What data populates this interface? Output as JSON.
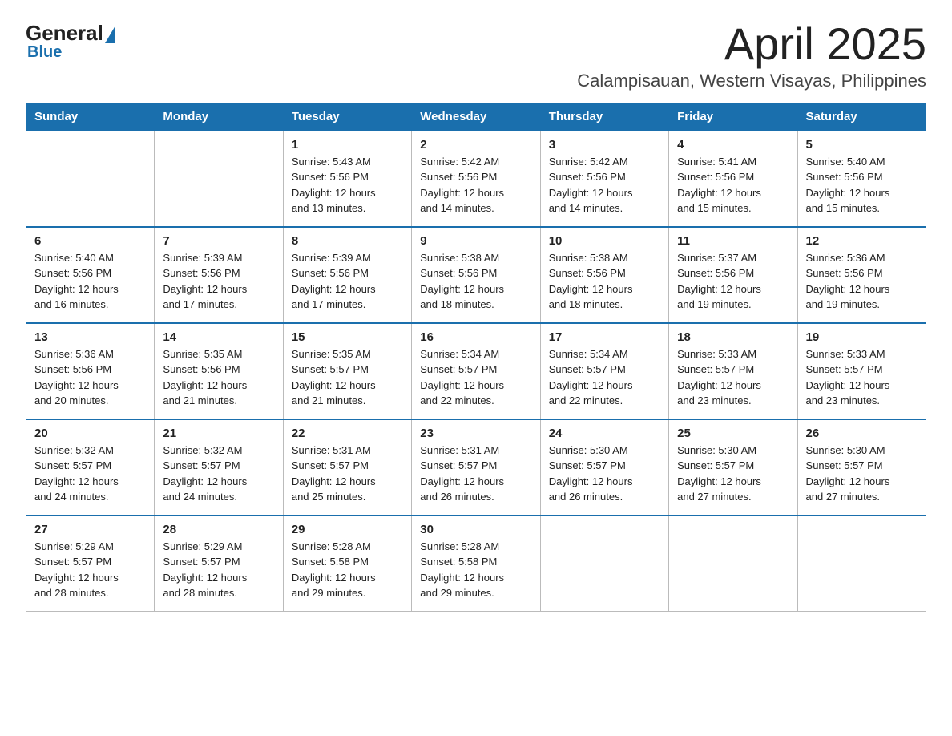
{
  "logo": {
    "general": "General",
    "blue": "Blue"
  },
  "title": "April 2025",
  "subtitle": "Calampisauan, Western Visayas, Philippines",
  "weekdays": [
    "Sunday",
    "Monday",
    "Tuesday",
    "Wednesday",
    "Thursday",
    "Friday",
    "Saturday"
  ],
  "weeks": [
    [
      {
        "day": "",
        "info": ""
      },
      {
        "day": "",
        "info": ""
      },
      {
        "day": "1",
        "info": "Sunrise: 5:43 AM\nSunset: 5:56 PM\nDaylight: 12 hours\nand 13 minutes."
      },
      {
        "day": "2",
        "info": "Sunrise: 5:42 AM\nSunset: 5:56 PM\nDaylight: 12 hours\nand 14 minutes."
      },
      {
        "day": "3",
        "info": "Sunrise: 5:42 AM\nSunset: 5:56 PM\nDaylight: 12 hours\nand 14 minutes."
      },
      {
        "day": "4",
        "info": "Sunrise: 5:41 AM\nSunset: 5:56 PM\nDaylight: 12 hours\nand 15 minutes."
      },
      {
        "day": "5",
        "info": "Sunrise: 5:40 AM\nSunset: 5:56 PM\nDaylight: 12 hours\nand 15 minutes."
      }
    ],
    [
      {
        "day": "6",
        "info": "Sunrise: 5:40 AM\nSunset: 5:56 PM\nDaylight: 12 hours\nand 16 minutes."
      },
      {
        "day": "7",
        "info": "Sunrise: 5:39 AM\nSunset: 5:56 PM\nDaylight: 12 hours\nand 17 minutes."
      },
      {
        "day": "8",
        "info": "Sunrise: 5:39 AM\nSunset: 5:56 PM\nDaylight: 12 hours\nand 17 minutes."
      },
      {
        "day": "9",
        "info": "Sunrise: 5:38 AM\nSunset: 5:56 PM\nDaylight: 12 hours\nand 18 minutes."
      },
      {
        "day": "10",
        "info": "Sunrise: 5:38 AM\nSunset: 5:56 PM\nDaylight: 12 hours\nand 18 minutes."
      },
      {
        "day": "11",
        "info": "Sunrise: 5:37 AM\nSunset: 5:56 PM\nDaylight: 12 hours\nand 19 minutes."
      },
      {
        "day": "12",
        "info": "Sunrise: 5:36 AM\nSunset: 5:56 PM\nDaylight: 12 hours\nand 19 minutes."
      }
    ],
    [
      {
        "day": "13",
        "info": "Sunrise: 5:36 AM\nSunset: 5:56 PM\nDaylight: 12 hours\nand 20 minutes."
      },
      {
        "day": "14",
        "info": "Sunrise: 5:35 AM\nSunset: 5:56 PM\nDaylight: 12 hours\nand 21 minutes."
      },
      {
        "day": "15",
        "info": "Sunrise: 5:35 AM\nSunset: 5:57 PM\nDaylight: 12 hours\nand 21 minutes."
      },
      {
        "day": "16",
        "info": "Sunrise: 5:34 AM\nSunset: 5:57 PM\nDaylight: 12 hours\nand 22 minutes."
      },
      {
        "day": "17",
        "info": "Sunrise: 5:34 AM\nSunset: 5:57 PM\nDaylight: 12 hours\nand 22 minutes."
      },
      {
        "day": "18",
        "info": "Sunrise: 5:33 AM\nSunset: 5:57 PM\nDaylight: 12 hours\nand 23 minutes."
      },
      {
        "day": "19",
        "info": "Sunrise: 5:33 AM\nSunset: 5:57 PM\nDaylight: 12 hours\nand 23 minutes."
      }
    ],
    [
      {
        "day": "20",
        "info": "Sunrise: 5:32 AM\nSunset: 5:57 PM\nDaylight: 12 hours\nand 24 minutes."
      },
      {
        "day": "21",
        "info": "Sunrise: 5:32 AM\nSunset: 5:57 PM\nDaylight: 12 hours\nand 24 minutes."
      },
      {
        "day": "22",
        "info": "Sunrise: 5:31 AM\nSunset: 5:57 PM\nDaylight: 12 hours\nand 25 minutes."
      },
      {
        "day": "23",
        "info": "Sunrise: 5:31 AM\nSunset: 5:57 PM\nDaylight: 12 hours\nand 26 minutes."
      },
      {
        "day": "24",
        "info": "Sunrise: 5:30 AM\nSunset: 5:57 PM\nDaylight: 12 hours\nand 26 minutes."
      },
      {
        "day": "25",
        "info": "Sunrise: 5:30 AM\nSunset: 5:57 PM\nDaylight: 12 hours\nand 27 minutes."
      },
      {
        "day": "26",
        "info": "Sunrise: 5:30 AM\nSunset: 5:57 PM\nDaylight: 12 hours\nand 27 minutes."
      }
    ],
    [
      {
        "day": "27",
        "info": "Sunrise: 5:29 AM\nSunset: 5:57 PM\nDaylight: 12 hours\nand 28 minutes."
      },
      {
        "day": "28",
        "info": "Sunrise: 5:29 AM\nSunset: 5:57 PM\nDaylight: 12 hours\nand 28 minutes."
      },
      {
        "day": "29",
        "info": "Sunrise: 5:28 AM\nSunset: 5:58 PM\nDaylight: 12 hours\nand 29 minutes."
      },
      {
        "day": "30",
        "info": "Sunrise: 5:28 AM\nSunset: 5:58 PM\nDaylight: 12 hours\nand 29 minutes."
      },
      {
        "day": "",
        "info": ""
      },
      {
        "day": "",
        "info": ""
      },
      {
        "day": "",
        "info": ""
      }
    ]
  ]
}
